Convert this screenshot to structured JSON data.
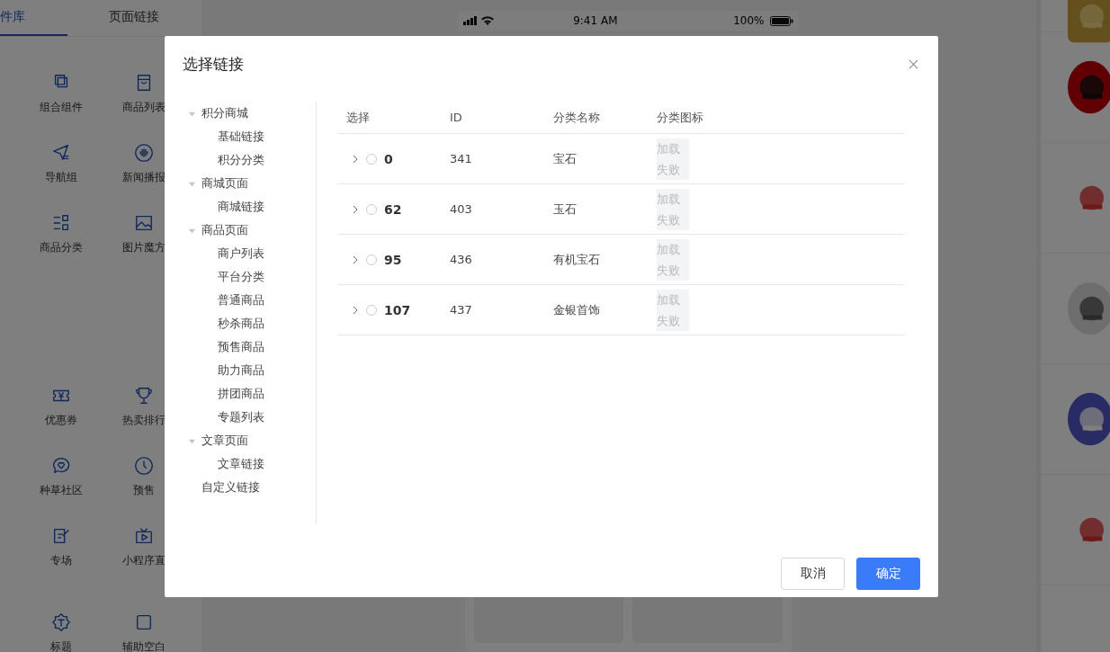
{
  "left_panel": {
    "tabs": [
      {
        "label": "件库",
        "selected": true
      },
      {
        "label": "页面链接",
        "selected": false
      }
    ],
    "component_groups": [
      [
        {
          "label": "组合组件"
        },
        {
          "label": "商品列表"
        },
        {
          "label": "导航组"
        },
        {
          "label": "新闻播报"
        },
        {
          "label": "商品分类"
        },
        {
          "label": "图片魔方"
        }
      ],
      [
        {
          "label": "优惠券"
        },
        {
          "label": "热卖排行"
        },
        {
          "label": "种草社区"
        },
        {
          "label": "预售"
        },
        {
          "label": "专场"
        },
        {
          "label": "小程序直"
        }
      ],
      [
        {
          "label": "标题"
        },
        {
          "label": "辅助空白"
        }
      ]
    ]
  },
  "phone": {
    "status_bar": {
      "time": "9:41 AM",
      "battery": "100%"
    }
  },
  "dialog": {
    "title": "选择链接",
    "tree": [
      {
        "label": "积分商城",
        "expanded": true,
        "children": [
          {
            "label": "基础链接"
          },
          {
            "label": "积分分类"
          }
        ]
      },
      {
        "label": "商城页面",
        "expanded": true,
        "children": [
          {
            "label": "商城链接"
          }
        ]
      },
      {
        "label": "商品页面",
        "expanded": true,
        "children": [
          {
            "label": "商户列表"
          },
          {
            "label": "平台分类"
          },
          {
            "label": "普通商品"
          },
          {
            "label": "秒杀商品"
          },
          {
            "label": "预售商品"
          },
          {
            "label": "助力商品"
          },
          {
            "label": "拼团商品"
          },
          {
            "label": "专题列表"
          }
        ]
      },
      {
        "label": "文章页面",
        "expanded": true,
        "children": [
          {
            "label": "文章链接"
          }
        ]
      },
      {
        "label": "自定义链接"
      }
    ],
    "table": {
      "columns": [
        "选择",
        "ID",
        "分类名称",
        "分类图标"
      ],
      "rows": [
        {
          "expanded": false,
          "selected": false,
          "value": "0",
          "id": "341",
          "name": "宝石",
          "icon": "加载失败"
        },
        {
          "expanded": false,
          "selected": false,
          "value": "62",
          "id": "403",
          "name": "玉石",
          "icon": "加载失败"
        },
        {
          "expanded": false,
          "selected": false,
          "value": "95",
          "id": "436",
          "name": "有机宝石",
          "icon": "加载失败"
        },
        {
          "expanded": false,
          "selected": false,
          "value": "107",
          "id": "437",
          "name": "金银首饰",
          "icon": "加载失败"
        }
      ]
    },
    "buttons": [
      {
        "kind": "secondary",
        "label": "取消"
      },
      {
        "kind": "primary",
        "label": "确定"
      }
    ]
  }
}
